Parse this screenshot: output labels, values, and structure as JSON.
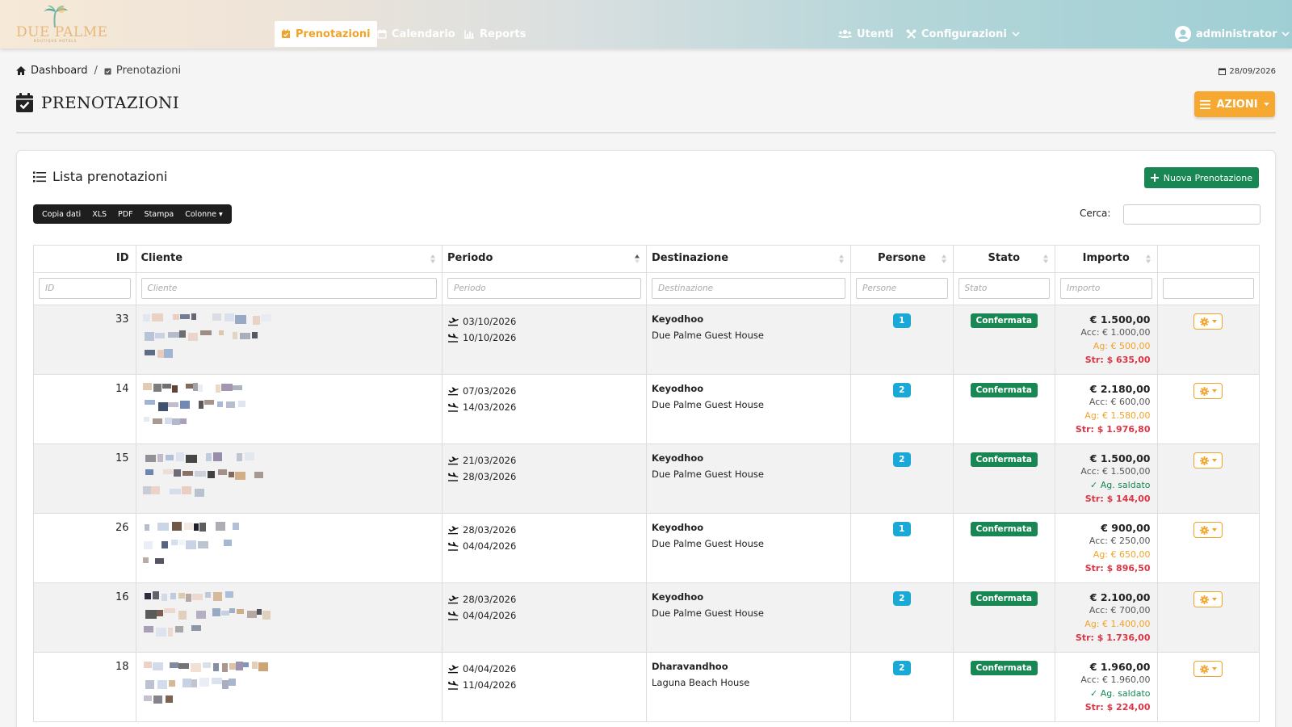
{
  "brand": {
    "name": "DUE PALME",
    "tagline": "BOUTIQUE HOTELS"
  },
  "nav": {
    "items": [
      {
        "label": "Prenotazioni",
        "icon": "calendar-check-icon",
        "active": true
      },
      {
        "label": "Calendario",
        "icon": "calendar-icon",
        "active": false
      },
      {
        "label": "Reports",
        "icon": "chart-icon",
        "active": false
      }
    ],
    "utenti": "Utenti",
    "configurazioni": "Configurazioni",
    "user": "administrator"
  },
  "breadcrumb": {
    "home": "Dashboard",
    "separator": "/",
    "current": "Prenotazioni"
  },
  "date": "28/09/2026",
  "page": {
    "title": "PRENOTAZIONI",
    "actions_label": "AZIONI"
  },
  "card": {
    "title": "Lista prenotazioni",
    "new_button": "Nuova Prenotazione",
    "export_buttons": [
      "Copia dati",
      "XLS",
      "PDF",
      "Stampa",
      "Colonne"
    ],
    "search_label": "Cerca:"
  },
  "table": {
    "columns": [
      "ID",
      "Cliente",
      "Periodo",
      "Destinazione",
      "Persone",
      "Stato",
      "Importo",
      ""
    ],
    "filters": [
      "ID",
      "Cliente",
      "Periodo",
      "Destinazione",
      "Persone",
      "Stato",
      "Importo",
      ""
    ],
    "rows": [
      {
        "id": "33",
        "arrival": "03/10/2026",
        "departure": "10/10/2026",
        "destination": "Keyodhoo",
        "hotel": "Due Palme Guest House",
        "persons": "1",
        "status": "Confermata",
        "total": "€ 1.500,00",
        "acc": "Acc: € 1.000,00",
        "ag": "Ag: € 500,00",
        "ag_saldato": false,
        "str": "Str: $ 635,00"
      },
      {
        "id": "14",
        "arrival": "07/03/2026",
        "departure": "14/03/2026",
        "destination": "Keyodhoo",
        "hotel": "Due Palme Guest House",
        "persons": "2",
        "status": "Confermata",
        "total": "€ 2.180,00",
        "acc": "Acc: € 600,00",
        "ag": "Ag: € 1.580,00",
        "ag_saldato": false,
        "str": "Str: $ 1.976,80"
      },
      {
        "id": "15",
        "arrival": "21/03/2026",
        "departure": "28/03/2026",
        "destination": "Keyodhoo",
        "hotel": "Due Palme Guest House",
        "persons": "2",
        "status": "Confermata",
        "total": "€ 1.500,00",
        "acc": "Acc: € 1.500,00",
        "ag": "✓ Ag. saldato",
        "ag_saldato": true,
        "str": "Str: $ 144,00"
      },
      {
        "id": "26",
        "arrival": "28/03/2026",
        "departure": "04/04/2026",
        "destination": "Keyodhoo",
        "hotel": "Due Palme Guest House",
        "persons": "1",
        "status": "Confermata",
        "total": "€ 900,00",
        "acc": "Acc: € 250,00",
        "ag": "Ag: € 650,00",
        "ag_saldato": false,
        "str": "Str: $ 896,50"
      },
      {
        "id": "16",
        "arrival": "28/03/2026",
        "departure": "04/04/2026",
        "destination": "Keyodhoo",
        "hotel": "Due Palme Guest House",
        "persons": "2",
        "status": "Confermata",
        "total": "€ 2.100,00",
        "acc": "Acc: € 700,00",
        "ag": "Ag: € 1.400,00",
        "ag_saldato": false,
        "str": "Str: $ 1.736,00"
      },
      {
        "id": "18",
        "arrival": "04/04/2026",
        "departure": "11/04/2026",
        "destination": "Dharavandhoo",
        "hotel": "Laguna Beach House",
        "persons": "2",
        "status": "Confermata",
        "total": "€ 1.960,00",
        "acc": "Acc: € 1.960,00",
        "ag": "✓ Ag. saldato",
        "ag_saldato": true,
        "str": "Str: $ 224,00"
      }
    ]
  },
  "colors": {
    "accent": "#f6a830",
    "success": "#198754",
    "info": "#1aa9d6",
    "danger": "#dc3545"
  }
}
